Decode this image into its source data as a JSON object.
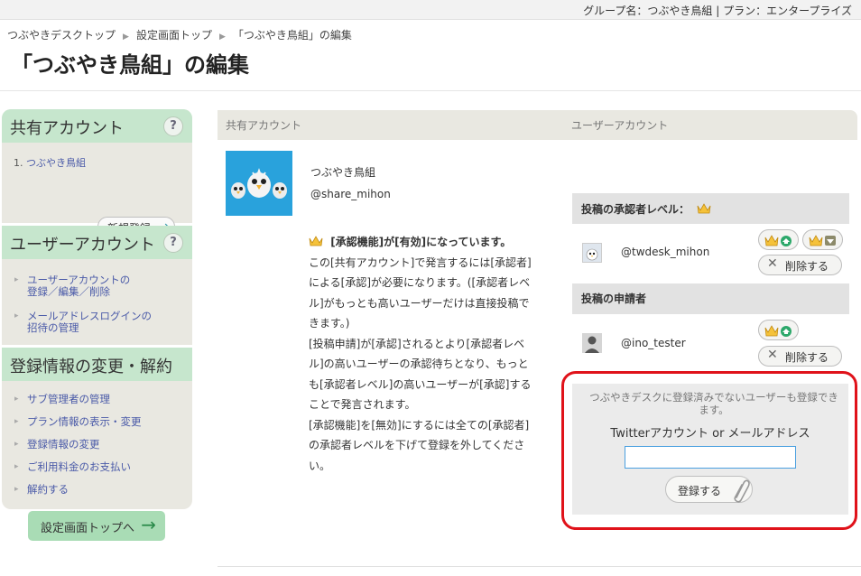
{
  "topbar": {
    "group_info": "グループ名：つぶやき鳥組 | プラン：エンタープライズ"
  },
  "breadcrumb": [
    "つぶやきデスクトップ",
    "設定画面トップ",
    "「つぶやき鳥組」の編集"
  ],
  "page_title": "「つぶやき鳥組」の編集",
  "sidebar": {
    "shared_heading": "共有アカウント",
    "help_label": "?",
    "shared_item_num": "1.",
    "shared_item": "つぶやき鳥組",
    "new_register": "新規登録",
    "user_heading": "ユーザーアカウント",
    "user_links": [
      [
        "ユーザーアカウントの",
        "登録／編集／削除"
      ],
      [
        "メールアドレスログインの",
        "招待の管理"
      ]
    ],
    "reg_heading": "登録情報の変更・解約",
    "reg_links": [
      "サブ管理者の管理",
      "プラン情報の表示・変更",
      "登録情報の変更",
      "ご利用料金のお支払い",
      "解約する"
    ],
    "settings_top": "設定画面トップへ"
  },
  "main": {
    "col_shared": "共有アカウント",
    "col_user": "ユーザーアカウント",
    "account_name": "つぶやき鳥組",
    "account_handle": "@share_mihon",
    "notice_title": "[承認機能]が[有効]になっています。",
    "notice_lines": [
      "この[共有アカウント]で発言するには[承認者]",
      "による[承認]が必要になります。([承認者レベ",
      "ル]がもっとも高いユーザーだけは直接投稿で",
      "きます。)",
      "[投稿申請]が[承認]されるとより[承認者レベ",
      "ル]の高いユーザーの承認待ちとなり、もっと",
      "も[承認者レベル]の高いユーザーが[承認]する",
      "ことで発言されます。",
      "[承認機能]を[無効]にするには全ての[承認者]",
      "の承認者レベルを下げて登録を外してくださ",
      "い。"
    ],
    "approver_heading": "投稿の承認者レベル：",
    "approver_handle": "@twdesk_mihon",
    "requester_heading": "投稿の申請者",
    "requester_handle": "@ino_tester",
    "delete_label": "削除する",
    "register_note": "つぶやきデスクに登録済みでないユーザーも登録できます。",
    "register_field_label": "Twitterアカウント or メールアドレス",
    "register_input_value": "",
    "register_button": "登録する"
  },
  "colors": {
    "accent_green": "#c6e6cd",
    "highlight_red": "#e0121a",
    "link_blue": "#4a5aa8",
    "avatar_blue": "#29a2dc"
  }
}
